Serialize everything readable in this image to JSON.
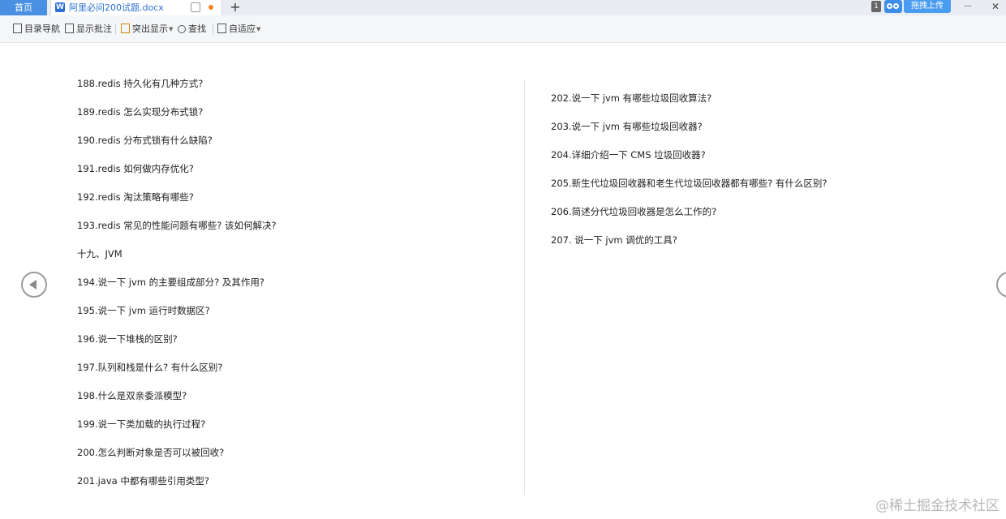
{
  "tabs": {
    "home_label": "首页",
    "doc_icon": "W",
    "doc_title": "阿里必问200试题.docx",
    "add_label": "+"
  },
  "window": {
    "badge_count": "1",
    "upload_label": "拖拽上传",
    "minimize_label": "—",
    "close_label": "✕"
  },
  "toolbar": {
    "items": [
      {
        "label": "目录导航",
        "icon": "outline-icon"
      },
      {
        "label": "显示批注",
        "icon": "comment-icon"
      },
      {
        "label": "突出显示",
        "icon": "highlight-icon"
      },
      {
        "label": "查找",
        "icon": "search-icon"
      },
      {
        "label": "自适应",
        "icon": "fit-page-icon"
      }
    ]
  },
  "document": {
    "left_lines": [
      "188.redis 持久化有几种方式?",
      "189.redis 怎么实现分布式锁?",
      "190.redis 分布式锁有什么缺陷?",
      "191.redis 如何做内存优化?",
      "192.redis 淘汰策略有哪些?",
      "193.redis 常见的性能问题有哪些? 该如何解决?",
      "十九、JVM",
      "194.说一下 jvm 的主要组成部分? 及其作用?",
      "195.说一下 jvm 运行时数据区?",
      "196.说一下堆栈的区别?",
      "197.队列和栈是什么? 有什么区别?",
      "198.什么是双亲委派模型?",
      "199.说一下类加载的执行过程?",
      "200.怎么判断对象是否可以被回收?",
      "201.java 中都有哪些引用类型?"
    ],
    "right_lines": [
      "202.说一下 jvm 有哪些垃圾回收算法?",
      "203.说一下 jvm 有哪些垃圾回收器?",
      "204.详细介绍一下 CMS 垃圾回收器?",
      "205.新生代垃圾回收器和老生代垃圾回收器都有哪些? 有什么区别?",
      "206.简述分代垃圾回收器是怎么工作的?",
      "207. 说一下 jvm 调优的工具?"
    ]
  },
  "watermark": "@稀土掘金技术社区"
}
